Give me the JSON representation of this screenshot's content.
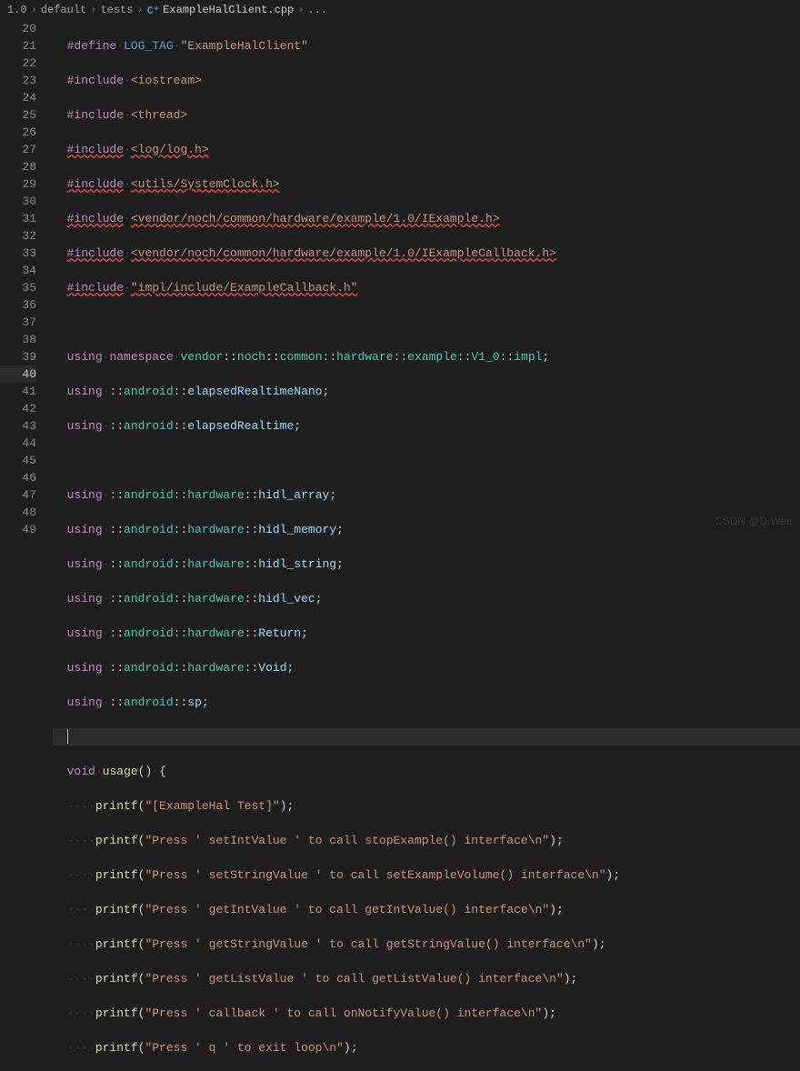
{
  "breadcrumbs": {
    "items": [
      "1.0",
      "default",
      "tests"
    ],
    "file": "ExampleHalClient.cpp",
    "trail": "..."
  },
  "gutter": [
    "20",
    "21",
    "22",
    "23",
    "24",
    "25",
    "26",
    "27",
    "28",
    "29",
    "30",
    "31",
    "32",
    "33",
    "34",
    "35",
    "36",
    "37",
    "38",
    "39",
    "40",
    "41",
    "42",
    "43",
    "44",
    "45",
    "46",
    "47",
    "48",
    "49"
  ],
  "code": {
    "define_label": "#define",
    "include_label": "#include",
    "using_label": "using",
    "namespace_label": "namespace",
    "void_label": "void",
    "log_tag_macro": "LOG_TAG",
    "log_tag_value": "\"ExampleHalClient\"",
    "inc_iostream": "<iostream>",
    "inc_thread": "<thread>",
    "inc_log": "<log/log.h>",
    "inc_sysclock": "<utils/SystemClock.h>",
    "inc_iexample": "<vendor/noch/common/hardware/example/1.0/IExample.h>",
    "inc_iexamplecb": "<vendor/noch/common/hardware/example/1.0/IExampleCallback.h>",
    "inc_impl": "\"impl/include/ExampleCallback.h\"",
    "ns_chain": {
      "vendor": "vendor",
      "noch": "noch",
      "common": "common",
      "hardware": "hardware",
      "example": "example",
      "v10": "V1_0",
      "impl": "impl",
      "android": "android",
      "sp": "sp"
    },
    "sym": {
      "elapsedRealtimeNano": "elapsedRealtimeNano",
      "elapsedRealtime": "elapsedRealtime",
      "hidl_array": "hidl_array",
      "hidl_memory": "hidl_memory",
      "hidl_string": "hidl_string",
      "hidl_vec": "hidl_vec",
      "Return": "Return",
      "Void": "Void"
    },
    "usage_fn": "usage",
    "printf_fn": "printf",
    "printf_lines": [
      "\"[ExampleHal Test]\"",
      "\"Press ' setIntValue ' to call stopExample() interface\\n\"",
      "\"Press ' setStringValue ' to call setExampleVolume() interface\\n\"",
      "\"Press ' getIntValue ' to call getIntValue() interface\\n\"",
      "\"Press ' getStringValue ' to call getStringValue() interface\\n\"",
      "\"Press ' getListValue ' to call getListValue() interface\\n\"",
      "\"Press ' callback ' to call onNotifyValue() interface\\n\"",
      "\"Press ' q ' to exit loop\\n\""
    ]
  },
  "watermark": "CSDN @D.Weir"
}
